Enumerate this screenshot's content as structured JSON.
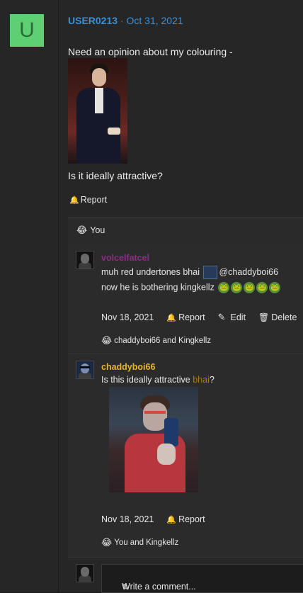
{
  "post": {
    "avatar_letter": "U",
    "username": "USER0213",
    "separator": "·",
    "date": "Oct 31, 2021",
    "text1": "Need an opinion about my colouring -",
    "text2": "Is it ideally attractive?",
    "report": "Report",
    "reaction_text": "You"
  },
  "comments": [
    {
      "user": "volcelfatcel",
      "line1_pre": "muh red undertones bhai",
      "mention": "@chaddyboi66",
      "line2": "now he is bothering kingkellz",
      "date": "Nov 18, 2021",
      "report": "Report",
      "edit": "Edit",
      "delete": "Delete",
      "reactions": "chaddyboi66 and Kingkellz"
    },
    {
      "user": "chaddyboi66",
      "text_pre": "Is this ideally attractive ",
      "text_highlight": "bhai",
      "text_post": "?",
      "date": "Nov 18, 2021",
      "report": "Report",
      "reactions": "You and Kingkellz"
    }
  ],
  "composer": {
    "placeholder": "Write a comment..."
  },
  "colors": {
    "username": "#3a8fd8",
    "volcelfatcel": "#8a2c84",
    "chaddyboi66": "#e5b72b",
    "avatar_bg": "#5fcf73"
  }
}
